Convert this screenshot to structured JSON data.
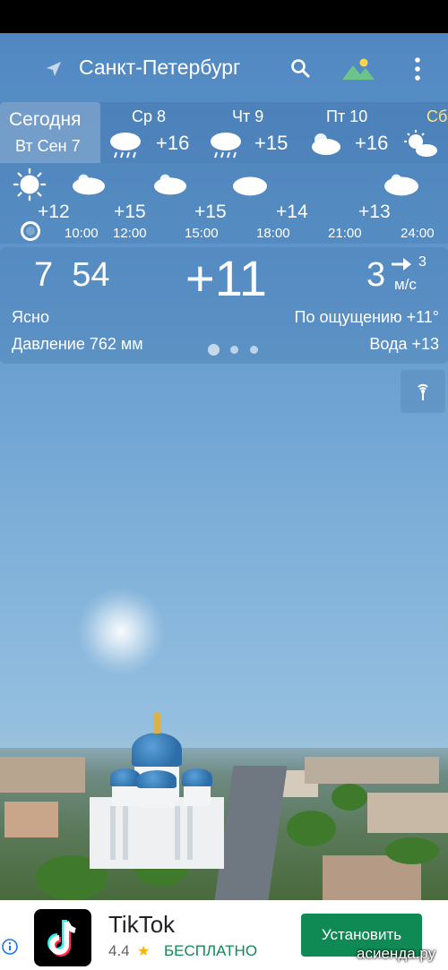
{
  "header": {
    "city": "Санкт-Петербург",
    "icons": [
      "navigation-arrow-icon",
      "search-icon",
      "background-image-icon",
      "more-vert-icon"
    ]
  },
  "days": {
    "today_label": "Сегодня",
    "today_date": "Вт Сен 7",
    "items": [
      {
        "label": "Ср 8",
        "temp": "+16",
        "icon": "rain-cloud-icon"
      },
      {
        "label": "Чт 9",
        "temp": "+15",
        "icon": "rain-cloud-icon"
      },
      {
        "label": "Пт 10",
        "temp": "+16",
        "icon": "partly-cloudy-icon"
      },
      {
        "label": "Сб",
        "temp": "",
        "icon": "sun-cloud-icon"
      }
    ]
  },
  "hourly": [
    {
      "temp": "+12",
      "time": "",
      "icon": "sun-icon"
    },
    {
      "temp": "+15",
      "time": "10:00",
      "icon": "partly-cloudy-icon"
    },
    {
      "temp": "+15",
      "time": "12:00",
      "icon": "partly-cloudy-icon"
    },
    {
      "temp": "",
      "time": "15:00",
      "icon": "cloud-icon"
    },
    {
      "temp": "+14",
      "time": "18:00",
      "icon": ""
    },
    {
      "temp": "+13",
      "time": "21:00",
      "icon": "partly-cloudy-icon"
    },
    {
      "temp": "",
      "time": "24:00",
      "icon": ""
    }
  ],
  "current": {
    "time": "7  54",
    "temp": "+11",
    "wind_speed": "3",
    "wind_gust": "3",
    "wind_unit": "м/с",
    "condition": "Ясно",
    "feels_like": "По ощущению +11°",
    "pressure": "Давление 762 мм",
    "water": "Вода +13",
    "page_index": 0,
    "page_count": 3
  },
  "ad": {
    "app_name": "TikTok",
    "rating": "4.4",
    "price": "БЕСПЛАТНО",
    "install_label": "Установить"
  },
  "watermark": "асиенда.ру",
  "colors": {
    "sky_top": "#4f86c0",
    "install_green": "#0f8a55",
    "star": "#f4b400",
    "label_yellow": "#ffe27a"
  }
}
